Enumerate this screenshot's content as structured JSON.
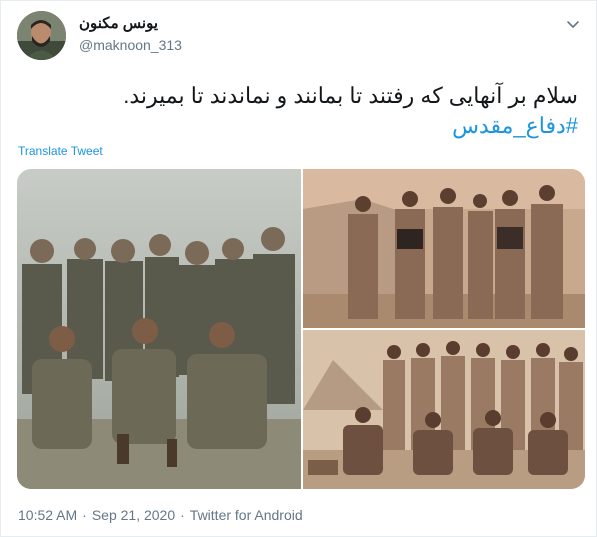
{
  "author": {
    "display_name": "یونس مکنون",
    "handle": "@maknoon_313"
  },
  "tweet": {
    "text_line1": "سلام بر آنهایی که رفتند تا بمانند و نماندند تا بمیرند.",
    "hashtag": "#دفاع_مقدس",
    "translate_label": "Translate Tweet"
  },
  "media": {
    "photos": [
      {
        "name": "group-photo-soldiers-crouching"
      },
      {
        "name": "group-photo-men-by-tents"
      },
      {
        "name": "group-photo-men-camp"
      }
    ]
  },
  "meta": {
    "time": "10:52 AM",
    "separator": "·",
    "date": "Sep 21, 2020",
    "source": "Twitter for Android"
  },
  "icons": {
    "more": "chevron-down-icon"
  },
  "colors": {
    "link": "#1b95e0",
    "secondary_text": "#657786",
    "border": "#e6ecf0"
  }
}
